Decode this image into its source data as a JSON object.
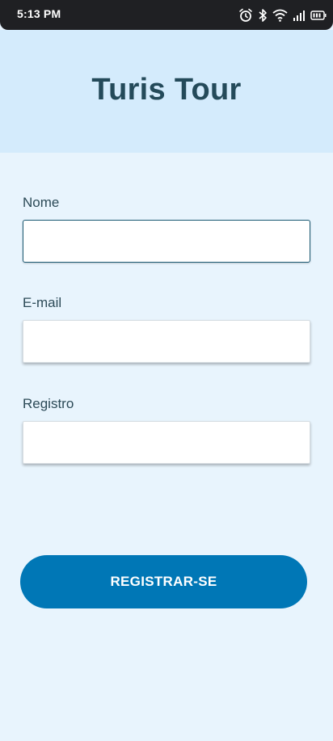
{
  "status_bar": {
    "time": "5:13 PM",
    "icons": [
      "alarm-icon",
      "bluetooth-icon",
      "wifi-icon",
      "signal-icon",
      "battery-icon"
    ]
  },
  "header": {
    "title": "Turis Tour",
    "background": "#d4ebfc"
  },
  "form": {
    "fields": [
      {
        "label": "Nome",
        "value": ""
      },
      {
        "label": "E-mail",
        "value": ""
      },
      {
        "label": "Registro",
        "value": ""
      }
    ],
    "submit_label": "REGISTRAR-SE"
  },
  "colors": {
    "page_background": "#e8f4fd",
    "primary": "#0077b6",
    "title_text": "#244a5a"
  }
}
